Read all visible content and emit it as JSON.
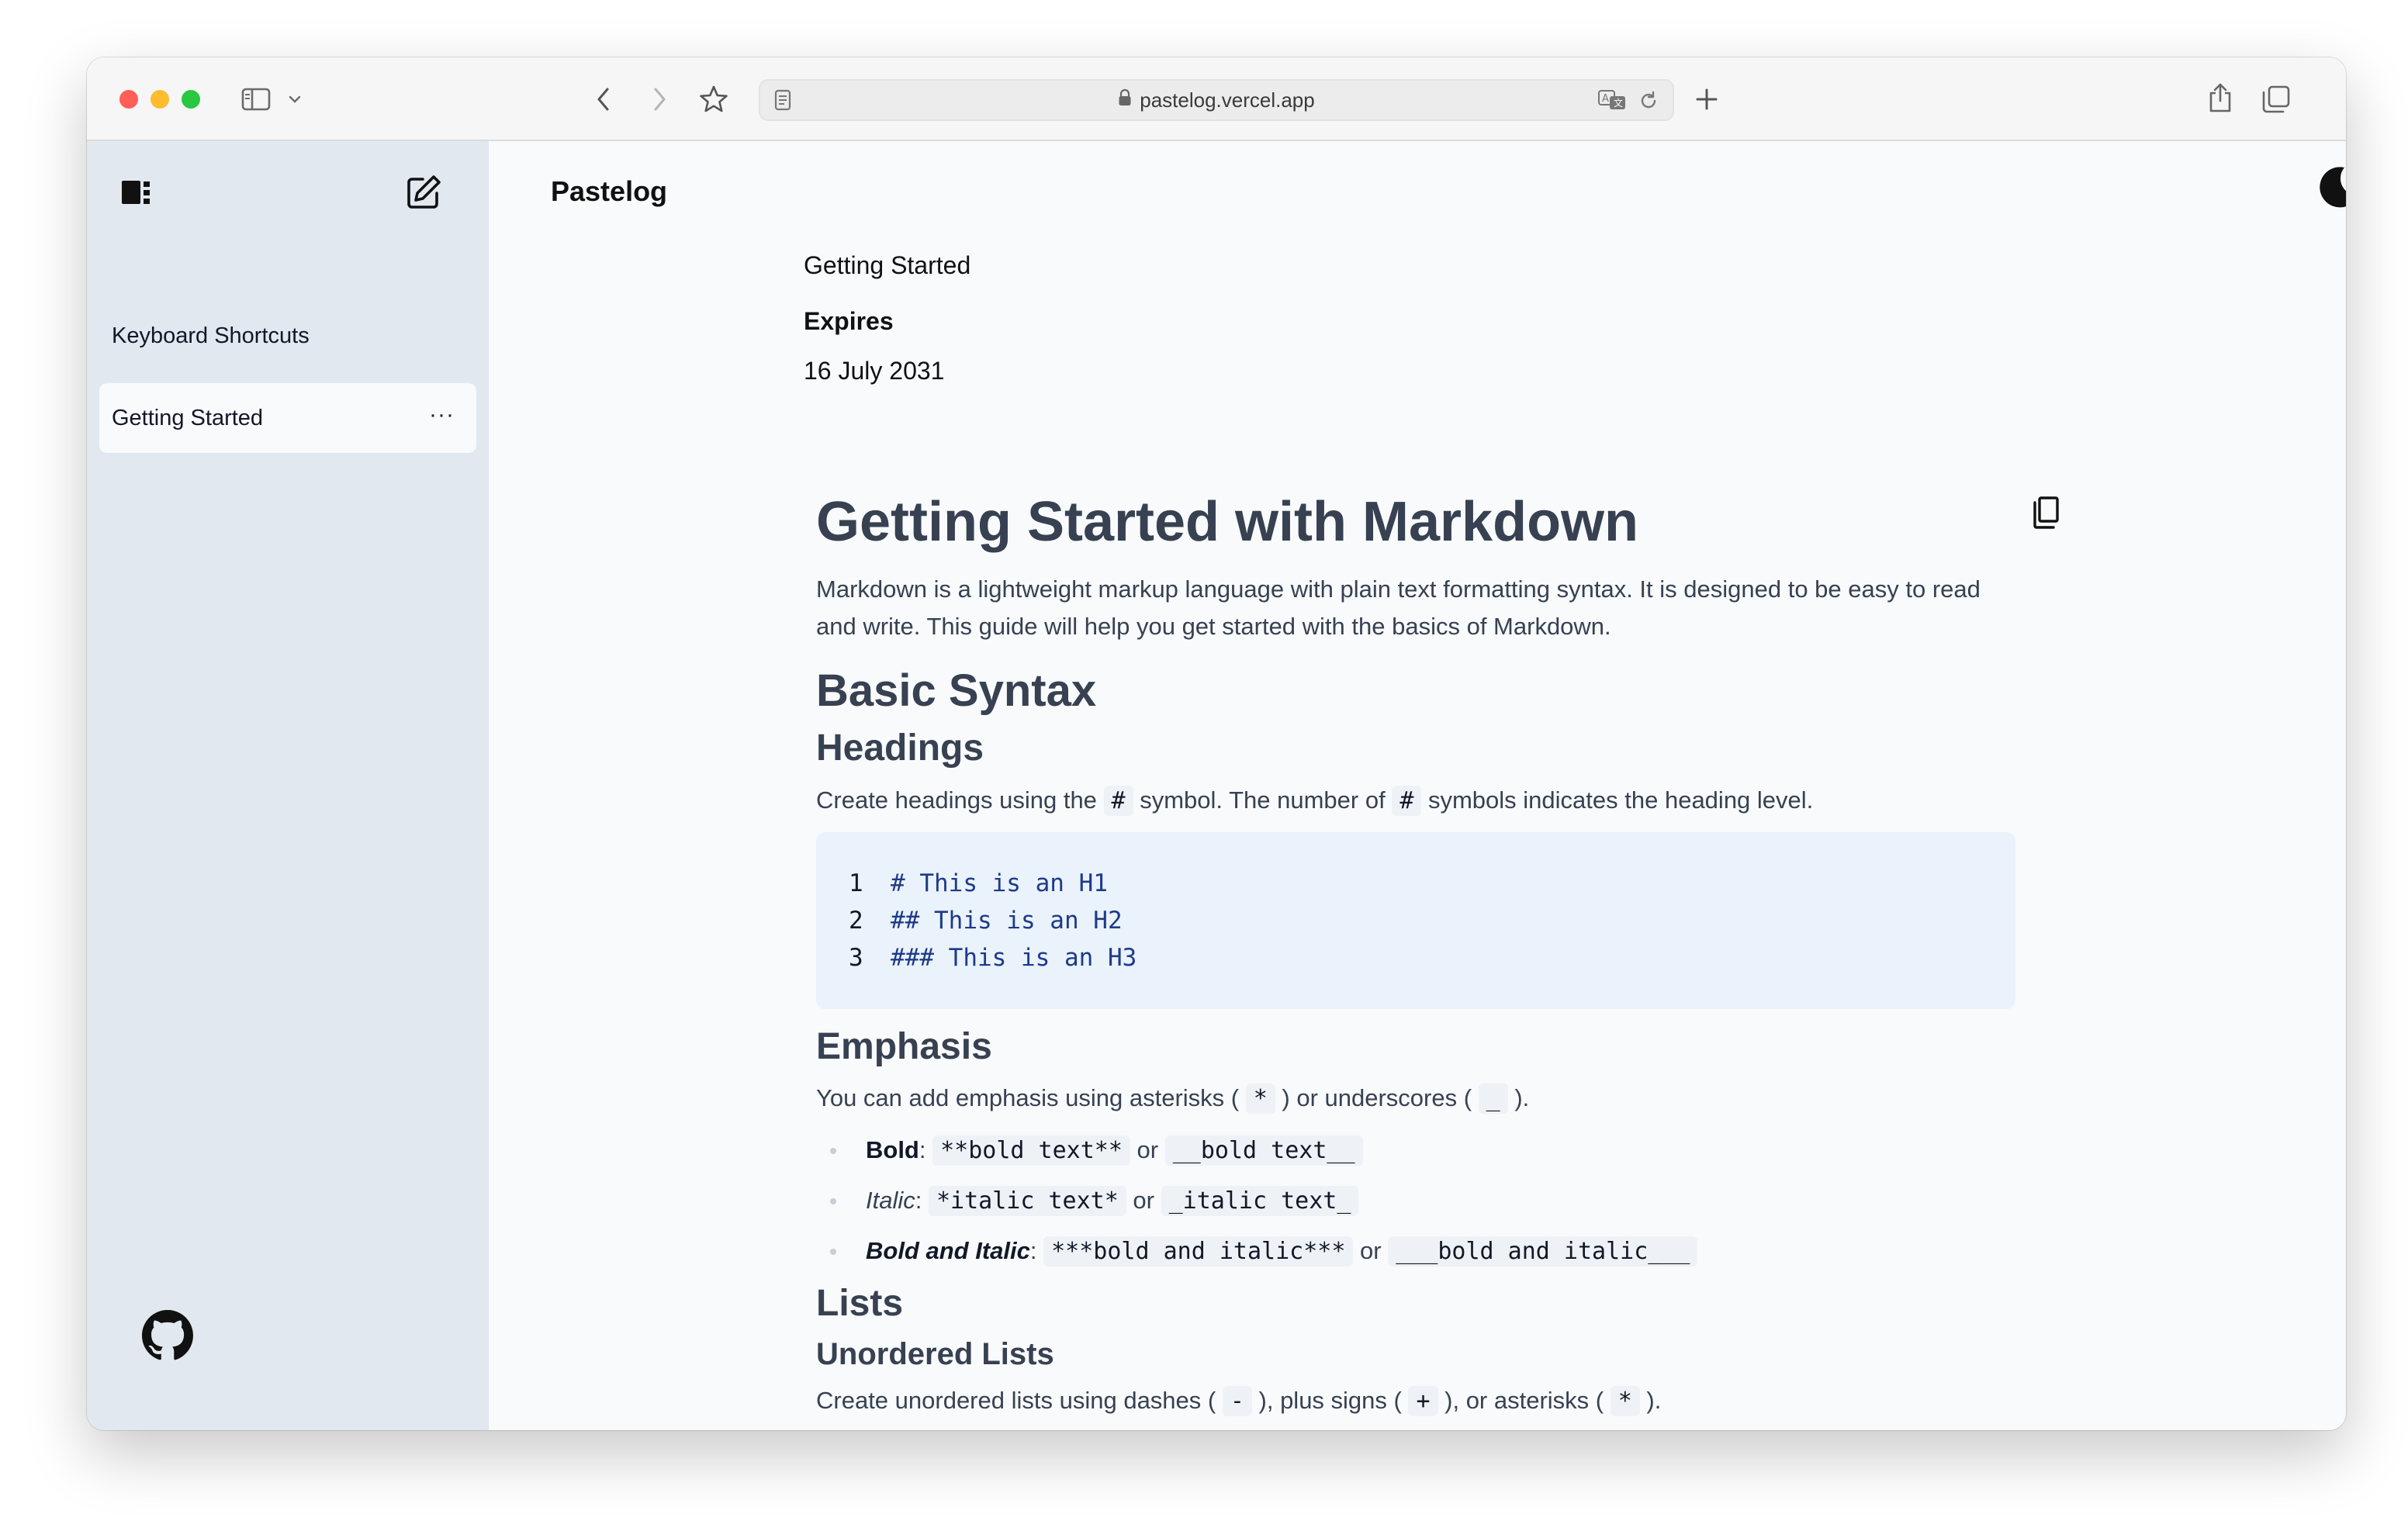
{
  "browser": {
    "url": "pastelog.vercel.app"
  },
  "sidebar": {
    "items": [
      {
        "label": "Keyboard Shortcuts"
      },
      {
        "label": "Getting Started",
        "more": "···"
      }
    ]
  },
  "header": {
    "brand": "Pastelog"
  },
  "meta": {
    "title": "Getting Started",
    "expires_label": "Expires",
    "expires_value": "16 July 2031"
  },
  "article": {
    "h1": "Getting Started with Markdown",
    "intro": "Markdown is a lightweight markup language with plain text formatting syntax. It is designed to be easy to read and write. This guide will help you get started with the basics of Markdown.",
    "basic_syntax": "Basic Syntax",
    "headings": {
      "title": "Headings",
      "text_1": "Create headings using the ",
      "code_1": "#",
      "text_2": " symbol. The number of ",
      "code_2": "#",
      "text_3": " symbols indicates the heading level.",
      "code_lines": [
        {
          "n": "1",
          "t": "# This is an H1"
        },
        {
          "n": "2",
          "t": "## This is an H2"
        },
        {
          "n": "3",
          "t": "### This is an H3"
        }
      ]
    },
    "emphasis": {
      "title": "Emphasis",
      "text_1": "You can add emphasis using asterisks ( ",
      "code_1": "*",
      "text_2": " ) or underscores ( ",
      "code_2": "_",
      "text_3": " ).",
      "items": [
        {
          "label": "Bold",
          "sep": ": ",
          "code_a": "**bold text**",
          "or": " or ",
          "code_b": "__bold text__"
        },
        {
          "label": "Italic",
          "sep": ": ",
          "code_a": "*italic text*",
          "or": " or ",
          "code_b": "_italic text_"
        },
        {
          "label": "Bold and Italic",
          "sep": ": ",
          "code_a": "***bold and italic***",
          "or": " or ",
          "code_b": "___bold and italic___"
        }
      ]
    },
    "lists": {
      "title": "Lists",
      "unordered_title": "Unordered Lists",
      "text_1": "Create unordered lists using dashes ( ",
      "code_1": "-",
      "text_2": " ), plus signs ( ",
      "code_2": "+",
      "text_3": " ), or asterisks ( ",
      "code_3": "*",
      "text_4": " )."
    }
  }
}
